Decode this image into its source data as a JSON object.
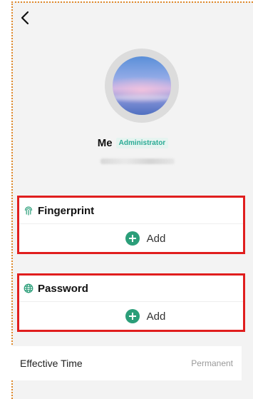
{
  "profile": {
    "name": "Me",
    "role": "Administrator"
  },
  "fingerprint": {
    "title": "Fingerprint",
    "add_label": "Add",
    "icon": "fingerprint-icon"
  },
  "password": {
    "title": "Password",
    "add_label": "Add",
    "icon": "password-globe-icon"
  },
  "effective_time": {
    "label": "Effective Time",
    "value": "Permanent"
  },
  "colors": {
    "accent": "#2b9e79",
    "badge_text": "#2bab95",
    "highlight": "#e01e1e",
    "frame_border": "#e0892a"
  }
}
